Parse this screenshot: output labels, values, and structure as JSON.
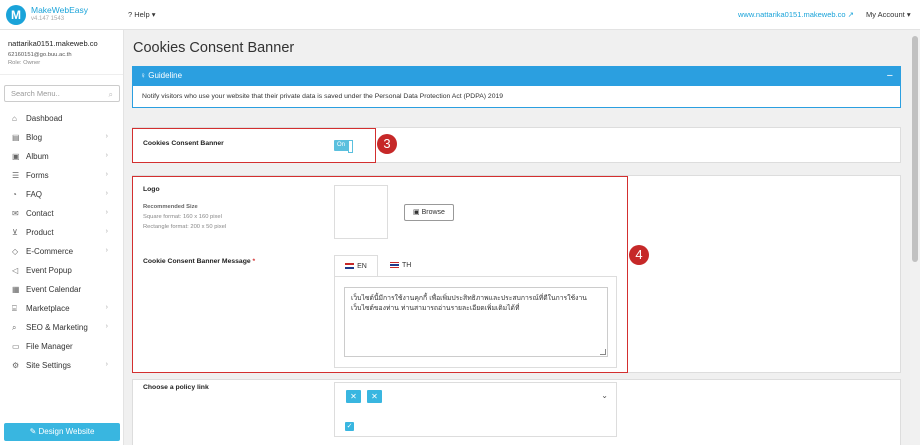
{
  "brand": {
    "name": "MakeWebEasy",
    "version": "v4.147 1543"
  },
  "topbar": {
    "help_label": "Help",
    "site_url": "www.nattarika0151.makeweb.co",
    "account_label": "My Account"
  },
  "user": {
    "name": "nattarika0151.makeweb.co",
    "email": "62160151@go.buu.ac.th",
    "role": "Role: Owner"
  },
  "sidebar": {
    "search_placeholder": "Search Menu..",
    "items": [
      {
        "label": "Dashboad",
        "icon": "home-icon",
        "has_children": false
      },
      {
        "label": "Blog",
        "icon": "document-icon",
        "has_children": true
      },
      {
        "label": "Album",
        "icon": "image-icon",
        "has_children": true
      },
      {
        "label": "Forms",
        "icon": "list-icon",
        "has_children": true
      },
      {
        "label": "FAQ",
        "icon": "chat-icon",
        "has_children": true
      },
      {
        "label": "Contact",
        "icon": "mail-icon",
        "has_children": true
      },
      {
        "label": "Product",
        "icon": "cart-icon",
        "has_children": true
      },
      {
        "label": "E-Commerce",
        "icon": "tag-icon",
        "has_children": true
      },
      {
        "label": "Event Popup",
        "icon": "megaphone-icon",
        "has_children": false
      },
      {
        "label": "Event Calendar",
        "icon": "calendar-icon",
        "has_children": false
      },
      {
        "label": "Marketplace",
        "icon": "storefront-icon",
        "has_children": true
      },
      {
        "label": "SEO & Marketing",
        "icon": "search-icon",
        "has_children": true
      },
      {
        "label": "File Manager",
        "icon": "folder-icon",
        "has_children": false
      },
      {
        "label": "Site Settings",
        "icon": "gear-icon",
        "has_children": true
      }
    ],
    "design_button": "Design Website"
  },
  "page": {
    "title": "Cookies Consent Banner",
    "guideline_title": "Guideline",
    "guideline_text": "Notify visitors who use your website that their private data is saved under the Personal Data Protection Act (PDPA) 2019",
    "banner_toggle_label": "Cookies Consent Banner",
    "banner_toggle_state": "On",
    "logo_label": "Logo",
    "recommended_size": "Recommended Size",
    "square_format": "Square format: 160 x 160 pixel",
    "rectangle_format": "Rectangle format: 200 x 50 pixel",
    "browse_button": "Browse",
    "message_label": "Cookie Consent Banner Message",
    "required_mark": "*",
    "tab_en": "EN",
    "tab_th": "TH",
    "message_text": "เว็บไซต์นี้มีการใช้งานคุกกี้ เพื่อเพิ่มประสิทธิภาพและประสบการณ์ที่ดีในการใช้งานเว็บไซต์ของท่าน  ท่านสามารถอ่านรายละเอียดเพิ่มเติมได้ที่",
    "policy_label": "Choose a policy link",
    "chip_x": "✕",
    "check_mark": "✓"
  },
  "annotations": {
    "marker_3": "3",
    "marker_4": "4"
  },
  "colors": {
    "accent": "#39b6e0",
    "guideline_blue": "#2b9fe0",
    "highlight_red": "#d32f2f"
  }
}
